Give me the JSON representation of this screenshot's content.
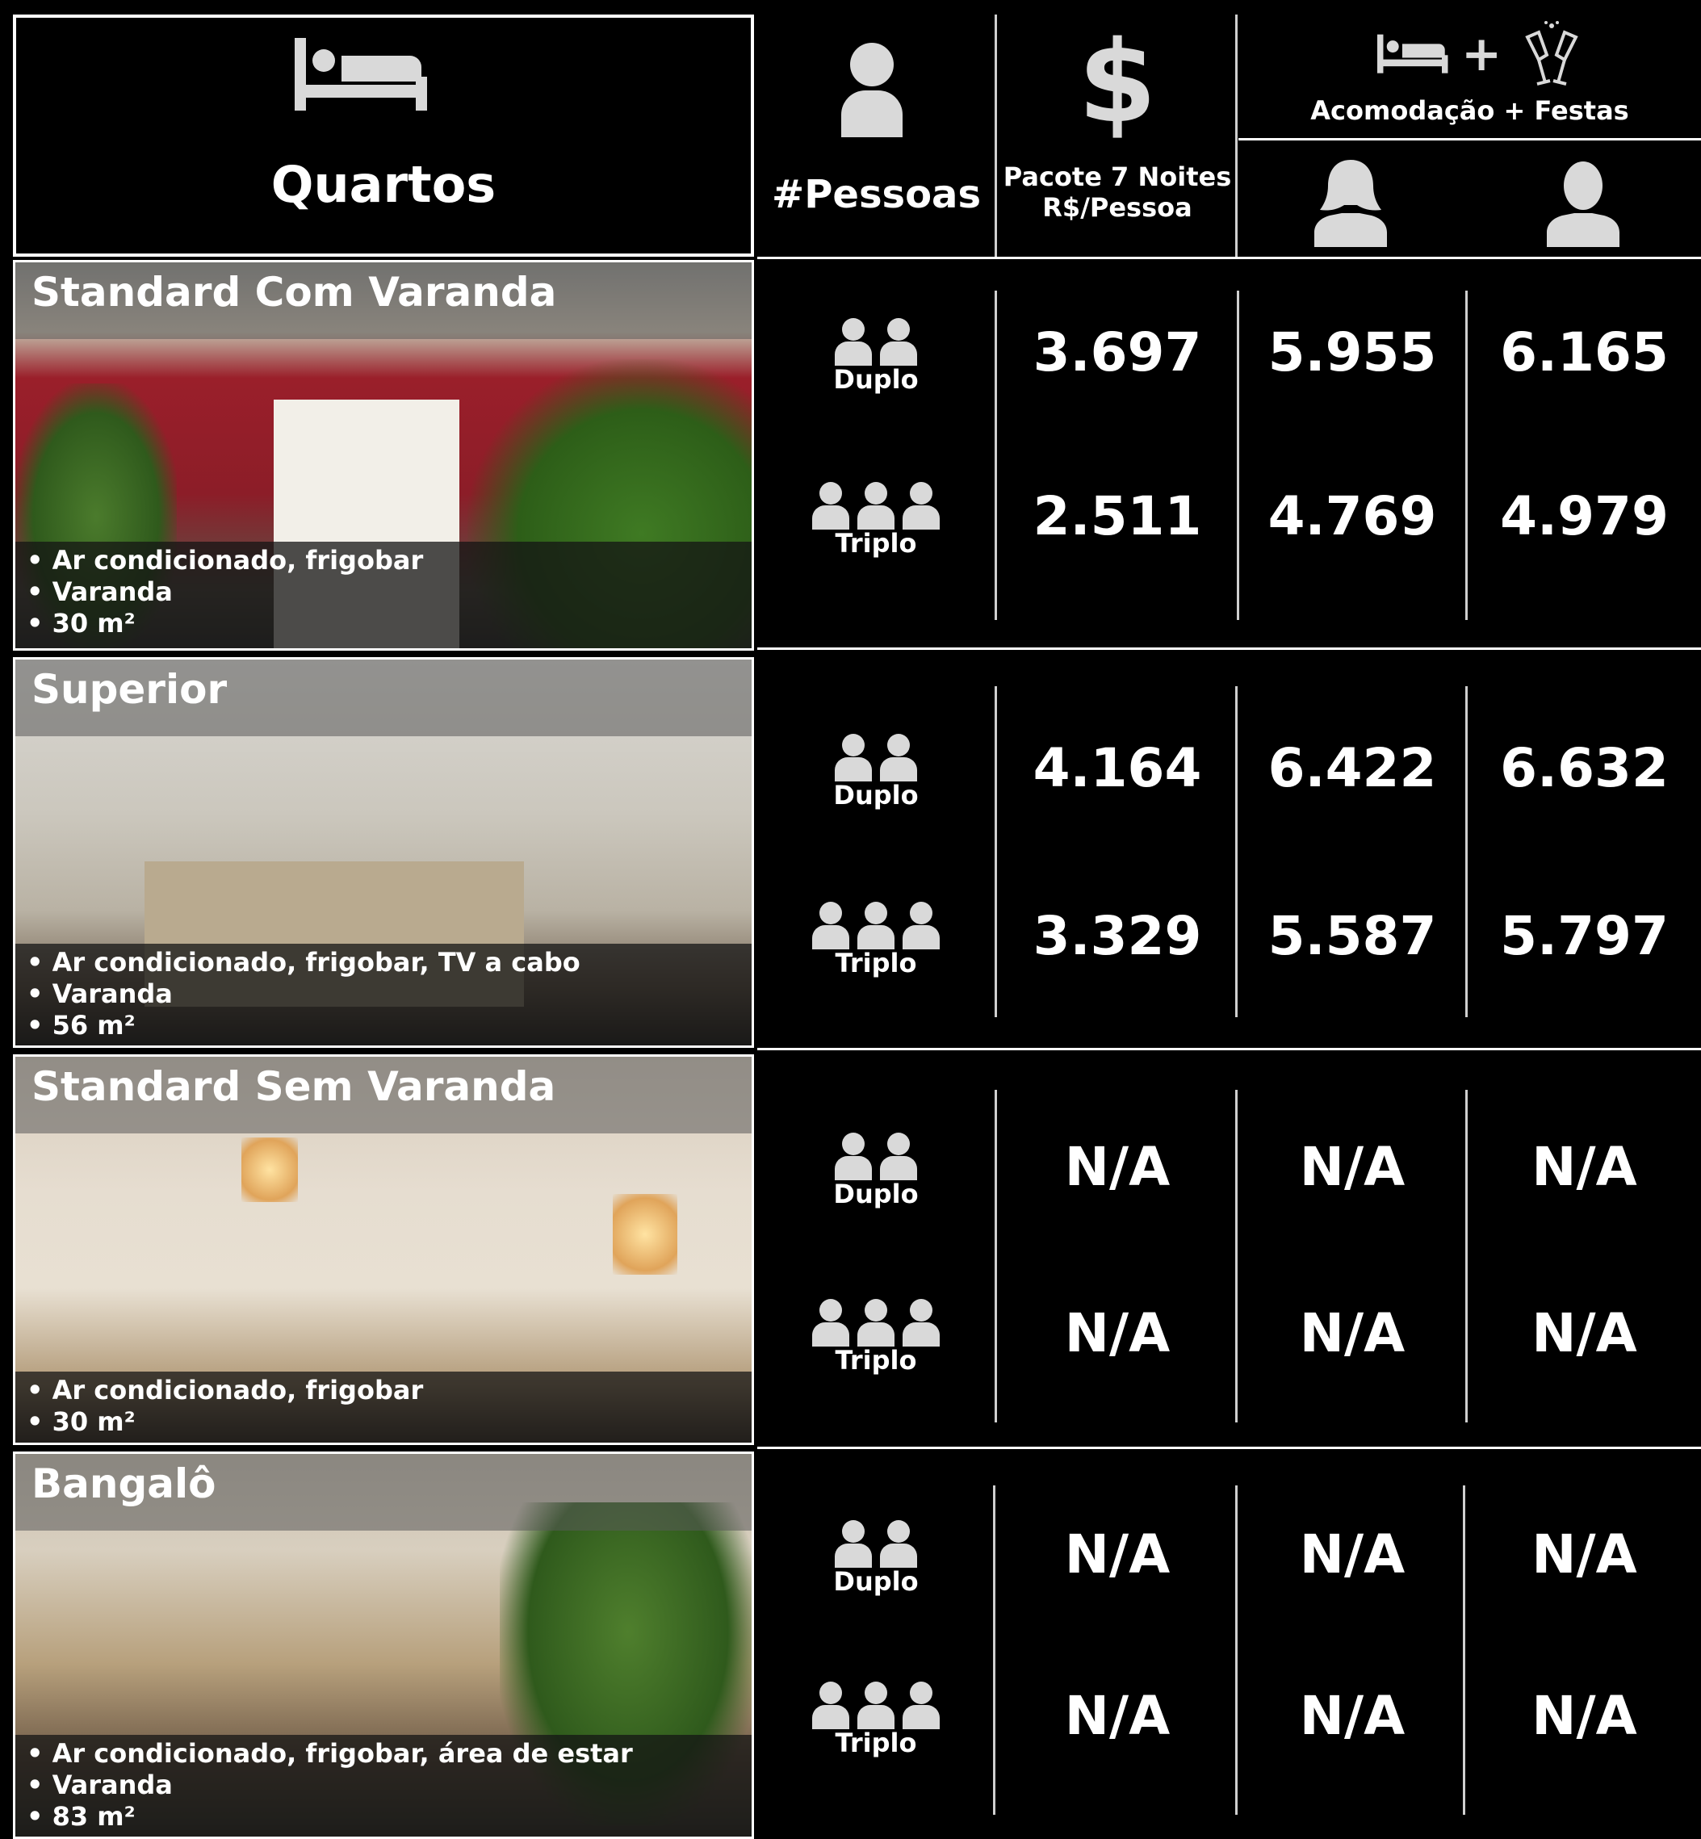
{
  "header": {
    "rooms_title": "Quartos",
    "people_title": "#Pessoas",
    "package_title_line1": "Pacote 7 Noites",
    "package_title_line2": "R$/Pessoa",
    "party_title": "Acomodação + Festas",
    "plus": "+"
  },
  "occupancy": {
    "double": "Duplo",
    "triple": "Triplo"
  },
  "rooms": [
    {
      "name": "Standard Com Varanda",
      "features": [
        "• Ar condicionado, frigobar",
        "• Varanda",
        "• 30 m²"
      ],
      "double": {
        "package": "3.697",
        "female": "5.955",
        "male": "6.165"
      },
      "triple": {
        "package": "2.511",
        "female": "4.769",
        "male": "4.979"
      }
    },
    {
      "name": "Superior",
      "features": [
        "• Ar condicionado, frigobar, TV a cabo",
        "• Varanda",
        "• 56 m²"
      ],
      "double": {
        "package": "4.164",
        "female": "6.422",
        "male": "6.632"
      },
      "triple": {
        "package": "3.329",
        "female": "5.587",
        "male": "5.797"
      }
    },
    {
      "name": "Standard Sem Varanda",
      "features": [
        "• Ar condicionado, frigobar",
        "• 30 m²"
      ],
      "double": {
        "package": "N/A",
        "female": "N/A",
        "male": "N/A"
      },
      "triple": {
        "package": "N/A",
        "female": "N/A",
        "male": "N/A"
      }
    },
    {
      "name": "Bangalô",
      "features": [
        "• Ar condicionado, frigobar, área de estar",
        "• Varanda",
        "• 83 m²"
      ],
      "double": {
        "package": "N/A",
        "female": "N/A",
        "male": "N/A"
      },
      "triple": {
        "package": "N/A",
        "female": "N/A",
        "male": "N/A"
      }
    }
  ],
  "icons": {
    "rooms": "bed-icon",
    "people": "person-icon",
    "package": "dollar-icon",
    "party": [
      "bed-icon",
      "champagne-icon"
    ],
    "female": "female-person-icon",
    "male": "male-person-icon"
  },
  "colors": {
    "background": "#000000",
    "text": "#ffffff",
    "icon": "#d9d9d9"
  }
}
